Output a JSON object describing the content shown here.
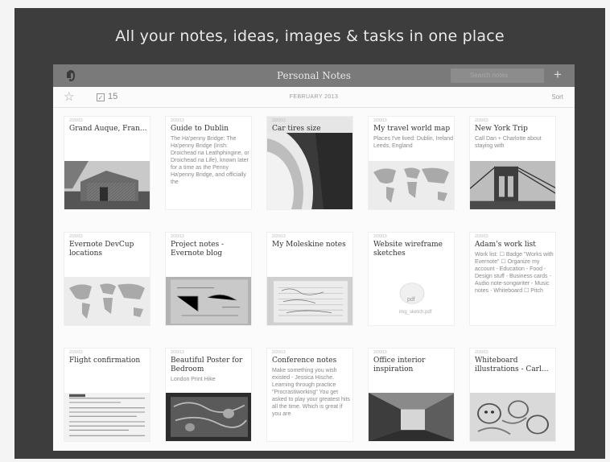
{
  "headline": "All your notes, ideas, images  & tasks in one place",
  "window": {
    "title": "Personal Notes",
    "search_placeholder": "Search notes",
    "add_label": "+"
  },
  "toolbar": {
    "count": "15",
    "month": "FEBRUARY 2013",
    "sort_label": "Sort"
  },
  "notes": [
    {
      "date": "2/20/13",
      "title": "Grand Auque, Fran...",
      "thumb": "barn-photo"
    },
    {
      "date": "2/20/13",
      "title": "Guide to Dublin",
      "body": "The Ha'penny Bridge: The Ha'penny Bridge (Irish: Droichead na Leathphingine, or Droichead na Life), known later for a time as the Penny Ha'penny Bridge, and officially the"
    },
    {
      "date": "2/20/13",
      "title": "Car tires size",
      "thumb": "tire-photo"
    },
    {
      "date": "2/20/13",
      "title": "My travel world map",
      "body": "Places I've lived: Dublin, Ireland Leeds, England",
      "thumb": "world-map"
    },
    {
      "date": "2/20/13",
      "title": "New York Trip",
      "body": "Call Dan + Charlotte about staying with",
      "thumb": "bridge-photo"
    },
    {
      "date": "2/20/13",
      "title": "Evernote DevCup locations",
      "thumb": "world-map"
    },
    {
      "date": "2/20/13",
      "title": "Project notes - Evernote blog",
      "thumb": "sketch-photo"
    },
    {
      "date": "2/20/13",
      "title": "My Moleskine notes",
      "thumb": "notebook-photo"
    },
    {
      "date": "2/20/13",
      "title": "Website wireframe sketches",
      "thumb": "pdf-icon",
      "pdf_text": "pdf",
      "pdf_name": "img_sketch.pdf"
    },
    {
      "date": "2/20/13",
      "title": "Adam's work list",
      "body": "Work list: ☐ Badge \"Works with Evernote\" ☐ Organize my account - Education - Food - Design stuff - Business cards - Audio note-songwriter - Music notes - Whiteboard ☐ Pitch"
    },
    {
      "date": "2/20/13",
      "title": "Flight confirmation",
      "thumb": "document-scan"
    },
    {
      "date": "2/20/13",
      "title": "Beautiful  Poster for Bedroom",
      "body": "London Print Hike",
      "thumb": "poster-photo"
    },
    {
      "date": "2/20/13",
      "title": "Conference notes",
      "body": "Make something you wish existed - Jessica Hische. Learning through practice \"Procrastiworking\" You get asked to play your greatest hits all the time. Which is great if you are"
    },
    {
      "date": "2/20/13",
      "title": "Office interior inspiration",
      "thumb": "office-photo"
    },
    {
      "date": "2/20/13",
      "title": "Whiteboard illustrations - Carl...",
      "thumb": "doodle-photo"
    }
  ]
}
